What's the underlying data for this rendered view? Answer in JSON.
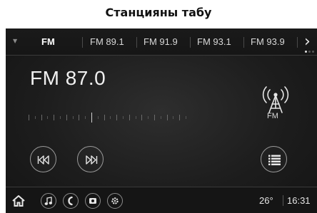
{
  "caption": "Станцияны табу",
  "tabs": [
    {
      "label": "FM",
      "active": true
    },
    {
      "label": "FM 89.1",
      "active": false
    },
    {
      "label": "FM 91.9",
      "active": false
    },
    {
      "label": "FM 93.1",
      "active": false
    },
    {
      "label": "FM 93.9",
      "active": false
    }
  ],
  "tab_more_glyph": "›",
  "page_indicator": {
    "pages": 3,
    "current": 1
  },
  "station": {
    "frequency_label": "FM 87.0",
    "band_label": "FM"
  },
  "controls": {
    "prev_icon": "skip-back-icon",
    "next_icon": "skip-forward-icon",
    "list_icon": "list-icon"
  },
  "statusbar": {
    "icons": [
      "home-icon",
      "music-icon",
      "phone-icon",
      "camera-icon",
      "settings-icon"
    ],
    "temperature": "26°",
    "time": "16:31"
  },
  "colors": {
    "background": "#1d1d1d",
    "text": "#e6e6e6",
    "border": "#9a9a9a"
  }
}
